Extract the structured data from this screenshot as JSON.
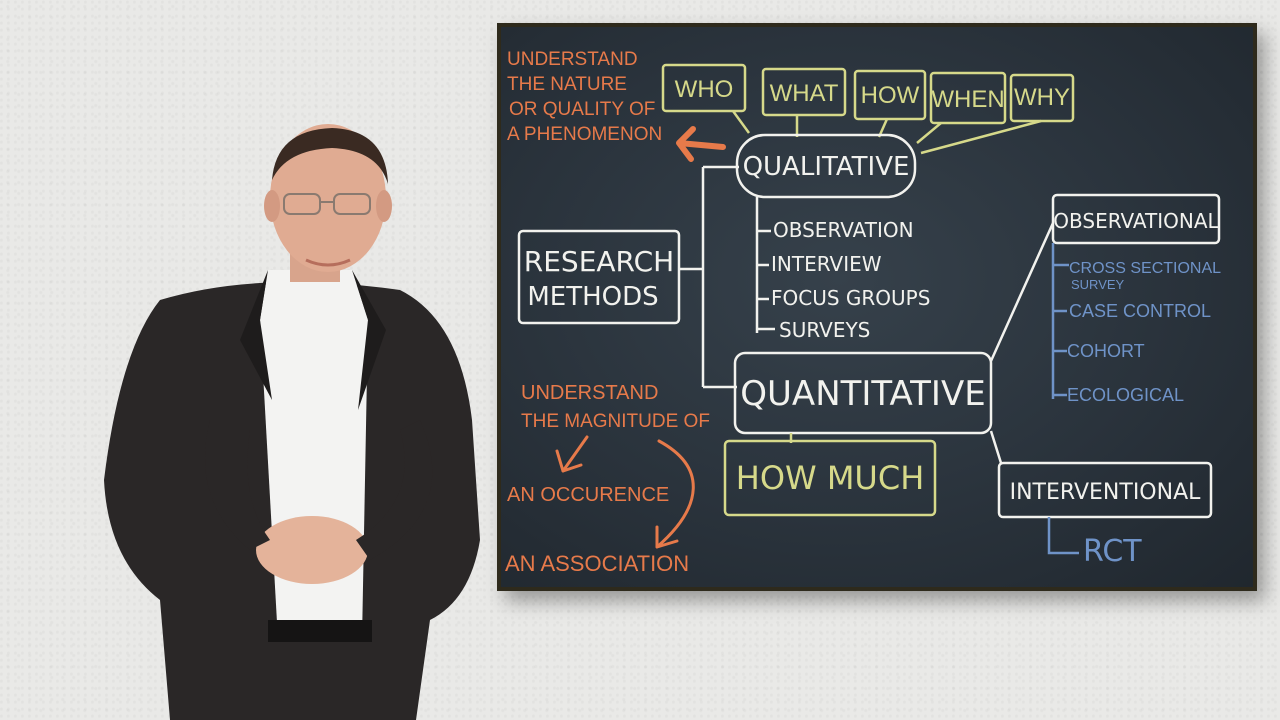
{
  "board": {
    "orange_top": [
      "UNDERSTAND",
      "THE NATURE",
      "OR QUALITY OF",
      "A PHENOMENON"
    ],
    "questions": [
      "WHO",
      "WHAT",
      "HOW",
      "WHEN",
      "WHY"
    ],
    "qualitative": "QUALITATIVE",
    "qualitative_methods": [
      "OBSERVATION",
      "INTERVIEW",
      "FOCUS GROUPS",
      "SURVEYS"
    ],
    "research_methods": [
      "RESEARCH",
      "METHODS"
    ],
    "quantitative": "QUANTITATIVE",
    "how_much": "HOW MUCH",
    "orange_bottom": [
      "UNDERSTAND",
      "THE MAGNITUDE OF"
    ],
    "an_occurence": "AN OCCURENCE",
    "an_association": "AN ASSOCIATION",
    "observational": "OBSERVATIONAL",
    "observational_types": [
      "CROSS SECTIONAL",
      "SURVEY",
      "CASE CONTROL",
      "COHORT",
      "ECOLOGICAL"
    ],
    "interventional": "INTERVENTIONAL",
    "rct": "RCT"
  },
  "colors": {
    "chalk_white": "#f2f2ee",
    "chalk_orange": "#e77a4a",
    "chalk_yellow": "#d6d98a",
    "chalk_blue": "#6f93c8"
  }
}
